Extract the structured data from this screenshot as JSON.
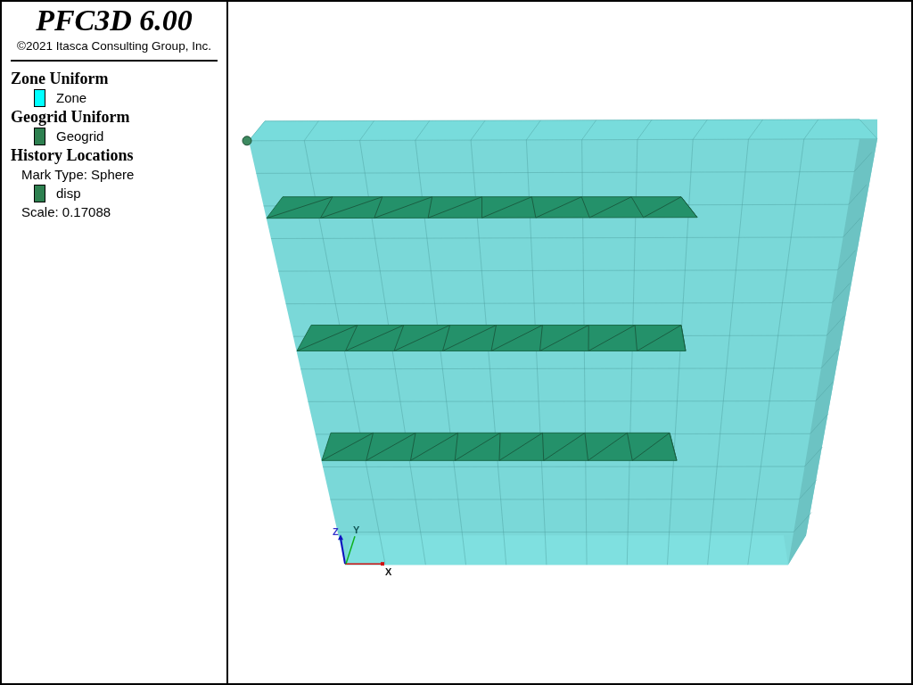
{
  "title": "PFC3D 6.00",
  "copyright": "©2021 Itasca Consulting Group, Inc.",
  "legend": [
    {
      "heading": "Zone Uniform",
      "items": [
        {
          "kind": "swatch",
          "label": "Zone",
          "color": "#00ffff"
        }
      ]
    },
    {
      "heading": "Geogrid Uniform",
      "items": [
        {
          "kind": "swatch",
          "label": "Geogrid",
          "color": "#2e8050"
        }
      ]
    },
    {
      "heading": "History Locations",
      "items": [
        {
          "kind": "text",
          "label": "Mark Type: Sphere"
        },
        {
          "kind": "swatch",
          "label": "disp",
          "color": "#2e8050"
        },
        {
          "kind": "text",
          "label": "Scale: 0.17088"
        }
      ]
    }
  ],
  "axes": {
    "x": "X",
    "y": "Y",
    "z": "Z"
  }
}
